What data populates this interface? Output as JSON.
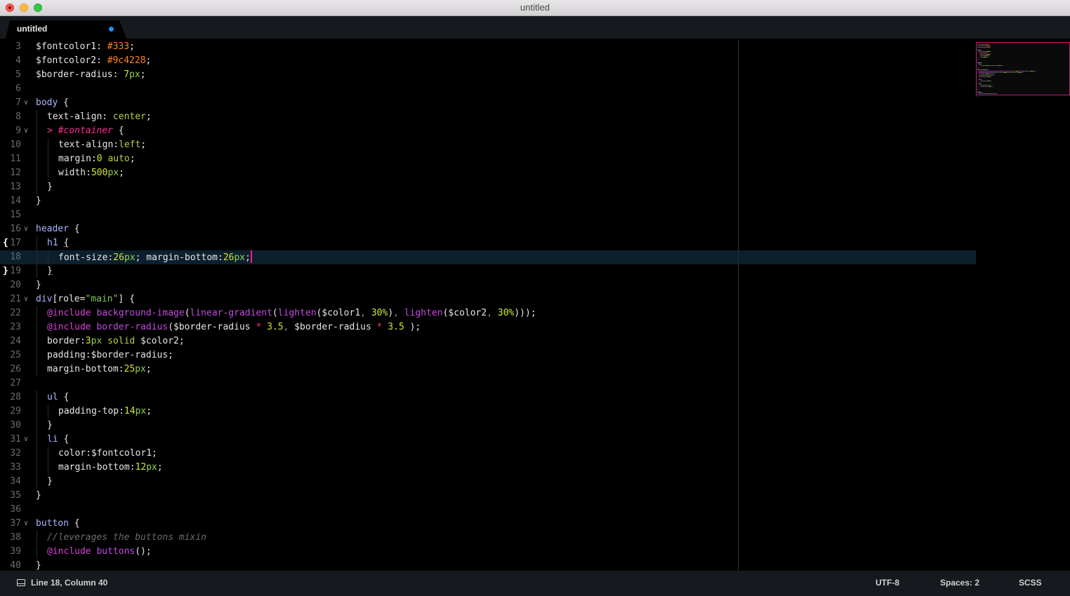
{
  "window": {
    "title": "untitled"
  },
  "tab": {
    "label": "untitled",
    "dirty": true
  },
  "editor": {
    "lines": [
      {
        "n": "3",
        "indent": 0,
        "tokens": [
          [
            "var",
            "$fontcolor1"
          ],
          [
            "sym",
            ": "
          ],
          [
            "hex",
            "#333"
          ],
          [
            "sym",
            ";"
          ]
        ]
      },
      {
        "n": "4",
        "indent": 0,
        "tokens": [
          [
            "var",
            "$fontcolor2"
          ],
          [
            "sym",
            ": "
          ],
          [
            "hex",
            "#9c4228"
          ],
          [
            "sym",
            ";"
          ]
        ]
      },
      {
        "n": "5",
        "indent": 0,
        "tokens": [
          [
            "var",
            "$border-radius"
          ],
          [
            "sym",
            ": "
          ],
          [
            "num",
            "7"
          ],
          [
            "unit",
            "px"
          ],
          [
            "sym",
            ";"
          ]
        ]
      },
      {
        "n": "6",
        "indent": 0,
        "tokens": []
      },
      {
        "n": "7",
        "indent": 0,
        "fold": true,
        "tokens": [
          [
            "sel",
            "body"
          ],
          [
            "sym",
            " {"
          ]
        ]
      },
      {
        "n": "8",
        "indent": 1,
        "tokens": [
          [
            "sym",
            "text-align: "
          ],
          [
            "kw",
            "center"
          ],
          [
            "sym",
            ";"
          ]
        ]
      },
      {
        "n": "9",
        "indent": 1,
        "fold": true,
        "tokens": [
          [
            "amp",
            "> "
          ],
          [
            "idsel",
            "#container"
          ],
          [
            "sym",
            " {"
          ]
        ]
      },
      {
        "n": "10",
        "indent": 2,
        "tokens": [
          [
            "sym",
            "text-align:"
          ],
          [
            "kw",
            "left"
          ],
          [
            "sym",
            ";"
          ]
        ]
      },
      {
        "n": "11",
        "indent": 2,
        "tokens": [
          [
            "sym",
            "margin:"
          ],
          [
            "num",
            "0"
          ],
          [
            "sym",
            " "
          ],
          [
            "kw",
            "auto"
          ],
          [
            "sym",
            ";"
          ]
        ]
      },
      {
        "n": "12",
        "indent": 2,
        "tokens": [
          [
            "sym",
            "width:"
          ],
          [
            "num",
            "500"
          ],
          [
            "unit",
            "px"
          ],
          [
            "sym",
            ";"
          ]
        ]
      },
      {
        "n": "13",
        "indent": 1,
        "tokens": [
          [
            "sym",
            "}"
          ]
        ]
      },
      {
        "n": "14",
        "indent": 0,
        "tokens": [
          [
            "sym",
            "}"
          ]
        ]
      },
      {
        "n": "15",
        "indent": 0,
        "tokens": []
      },
      {
        "n": "16",
        "indent": 0,
        "fold": true,
        "tokens": [
          [
            "sel",
            "header"
          ],
          [
            "sym",
            " {"
          ]
        ]
      },
      {
        "n": "17",
        "indent": 1,
        "mark": "{",
        "tokens": [
          [
            "sel",
            "h1"
          ],
          [
            "sym",
            " "
          ],
          [
            "symu",
            "{"
          ]
        ]
      },
      {
        "n": "18",
        "indent": 2,
        "current": true,
        "caret": true,
        "tokens": [
          [
            "sym",
            "font-size:"
          ],
          [
            "num",
            "26"
          ],
          [
            "unit",
            "px"
          ],
          [
            "sym",
            "; margin-bottom:"
          ],
          [
            "num",
            "26"
          ],
          [
            "unit",
            "px"
          ],
          [
            "sym",
            ";"
          ]
        ]
      },
      {
        "n": "19",
        "indent": 1,
        "mark": "}",
        "tokens": [
          [
            "symu",
            "}"
          ]
        ]
      },
      {
        "n": "20",
        "indent": 0,
        "tokens": [
          [
            "sym",
            "}"
          ]
        ]
      },
      {
        "n": "21",
        "indent": 0,
        "fold": true,
        "tokens": [
          [
            "sel",
            "div"
          ],
          [
            "sym",
            "[role="
          ],
          [
            "str",
            "\"main\""
          ],
          [
            "sym",
            "] {"
          ]
        ]
      },
      {
        "n": "22",
        "indent": 1,
        "tokens": [
          [
            "at",
            "@include"
          ],
          [
            "sym",
            " "
          ],
          [
            "fn",
            "background-image"
          ],
          [
            "sym",
            "("
          ],
          [
            "fn",
            "linear-gradient"
          ],
          [
            "sym",
            "("
          ],
          [
            "fn",
            "lighten"
          ],
          [
            "sym",
            "($color1"
          ],
          [
            "punc",
            ", "
          ],
          [
            "num",
            "30%"
          ],
          [
            "sym",
            ")"
          ],
          [
            "punc",
            ", "
          ],
          [
            "fn",
            "lighten"
          ],
          [
            "sym",
            "($color2"
          ],
          [
            "punc",
            ", "
          ],
          [
            "num",
            "30%"
          ],
          [
            "sym",
            ")));"
          ]
        ]
      },
      {
        "n": "23",
        "indent": 1,
        "tokens": [
          [
            "at",
            "@include"
          ],
          [
            "sym",
            " "
          ],
          [
            "fn",
            "border-radius"
          ],
          [
            "sym",
            "($border-radius "
          ],
          [
            "op",
            "*"
          ],
          [
            "sym",
            " "
          ],
          [
            "num",
            "3.5"
          ],
          [
            "punc",
            ", "
          ],
          [
            "sym",
            "$border-radius "
          ],
          [
            "op",
            "*"
          ],
          [
            "sym",
            " "
          ],
          [
            "num",
            "3.5"
          ],
          [
            "sym",
            " );"
          ]
        ]
      },
      {
        "n": "24",
        "indent": 1,
        "tokens": [
          [
            "sym",
            "border:"
          ],
          [
            "num",
            "3"
          ],
          [
            "unit",
            "px"
          ],
          [
            "sym",
            " "
          ],
          [
            "kw",
            "solid"
          ],
          [
            "sym",
            " $color2;"
          ]
        ]
      },
      {
        "n": "25",
        "indent": 1,
        "tokens": [
          [
            "sym",
            "padding:$border-radius;"
          ]
        ]
      },
      {
        "n": "26",
        "indent": 1,
        "tokens": [
          [
            "sym",
            "margin-bottom:"
          ],
          [
            "num",
            "25"
          ],
          [
            "unit",
            "px"
          ],
          [
            "sym",
            ";"
          ]
        ]
      },
      {
        "n": "27",
        "indent": 0,
        "tokens": []
      },
      {
        "n": "28",
        "indent": 1,
        "tokens": [
          [
            "sel",
            "ul"
          ],
          [
            "sym",
            " {"
          ]
        ]
      },
      {
        "n": "29",
        "indent": 2,
        "tokens": [
          [
            "sym",
            "padding-top:"
          ],
          [
            "num",
            "14"
          ],
          [
            "unit",
            "px"
          ],
          [
            "sym",
            ";"
          ]
        ]
      },
      {
        "n": "30",
        "indent": 1,
        "tokens": [
          [
            "sym",
            "}"
          ]
        ]
      },
      {
        "n": "31",
        "indent": 1,
        "fold": true,
        "tokens": [
          [
            "sel",
            "li"
          ],
          [
            "sym",
            " {"
          ]
        ]
      },
      {
        "n": "32",
        "indent": 2,
        "tokens": [
          [
            "sym",
            "color:$fontcolor1;"
          ]
        ]
      },
      {
        "n": "33",
        "indent": 2,
        "tokens": [
          [
            "sym",
            "margin-bottom:"
          ],
          [
            "num",
            "12"
          ],
          [
            "unit",
            "px"
          ],
          [
            "sym",
            ";"
          ]
        ]
      },
      {
        "n": "34",
        "indent": 1,
        "tokens": [
          [
            "sym",
            "}"
          ]
        ]
      },
      {
        "n": "35",
        "indent": 0,
        "tokens": [
          [
            "sym",
            "}"
          ]
        ]
      },
      {
        "n": "36",
        "indent": 0,
        "tokens": []
      },
      {
        "n": "37",
        "indent": 0,
        "fold": true,
        "tokens": [
          [
            "sel",
            "button"
          ],
          [
            "sym",
            " {"
          ]
        ]
      },
      {
        "n": "38",
        "indent": 1,
        "tokens": [
          [
            "cmt",
            "//leverages the buttons mixin"
          ]
        ]
      },
      {
        "n": "39",
        "indent": 1,
        "tokens": [
          [
            "at",
            "@include"
          ],
          [
            "sym",
            " "
          ],
          [
            "fn",
            "buttons"
          ],
          [
            "sym",
            "();"
          ]
        ]
      },
      {
        "n": "40",
        "indent": 0,
        "tokens": [
          [
            "sym",
            "}"
          ]
        ]
      }
    ]
  },
  "status": {
    "position": "Line 18, Column 40",
    "encoding": "UTF-8",
    "indentation": "Spaces: 2",
    "syntax": "SCSS"
  },
  "colors": {
    "background": "#000000",
    "current_line": "#0c1f2d",
    "caret": "#ff1f8e",
    "tab_dirty_dot": "#1e90ff",
    "minimap_viewport": "#c2186b"
  },
  "icons": {
    "close": "close-icon",
    "minimize": "minimize-icon",
    "maximize": "maximize-icon",
    "fold": "chevron-down-icon",
    "panel": "panel-toggle-icon"
  }
}
